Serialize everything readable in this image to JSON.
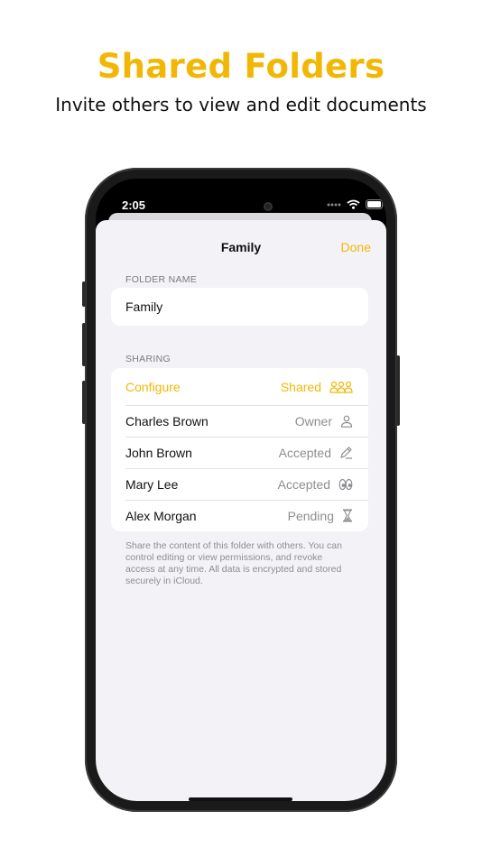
{
  "promo": {
    "headline": "Shared Folders",
    "subhead": "Invite others to view and edit documents"
  },
  "status_bar": {
    "time": "2:05"
  },
  "nav": {
    "title": "Family",
    "done_label": "Done"
  },
  "folder_section": {
    "label": "FOLDER NAME",
    "value": "Family"
  },
  "sharing_section": {
    "label": "SHARING",
    "configure": {
      "label": "Configure",
      "status": "Shared",
      "icon": "people-group-icon"
    },
    "members": [
      {
        "name": "Charles Brown",
        "status": "Owner",
        "icon": "person-icon"
      },
      {
        "name": "John Brown",
        "status": "Accepted",
        "icon": "pencil-icon"
      },
      {
        "name": "Mary Lee",
        "status": "Accepted",
        "icon": "eyes-icon"
      },
      {
        "name": "Alex Morgan",
        "status": "Pending",
        "icon": "hourglass-icon"
      }
    ],
    "footnote": "Share the content of this folder with others. You can control editing or view permissions, and revoke access at any time. All data is encrypted and stored securely in iCloud."
  },
  "colors": {
    "accent": "#F2B705",
    "background": "#F2F2F7",
    "secondary_text": "#8e8e93"
  }
}
